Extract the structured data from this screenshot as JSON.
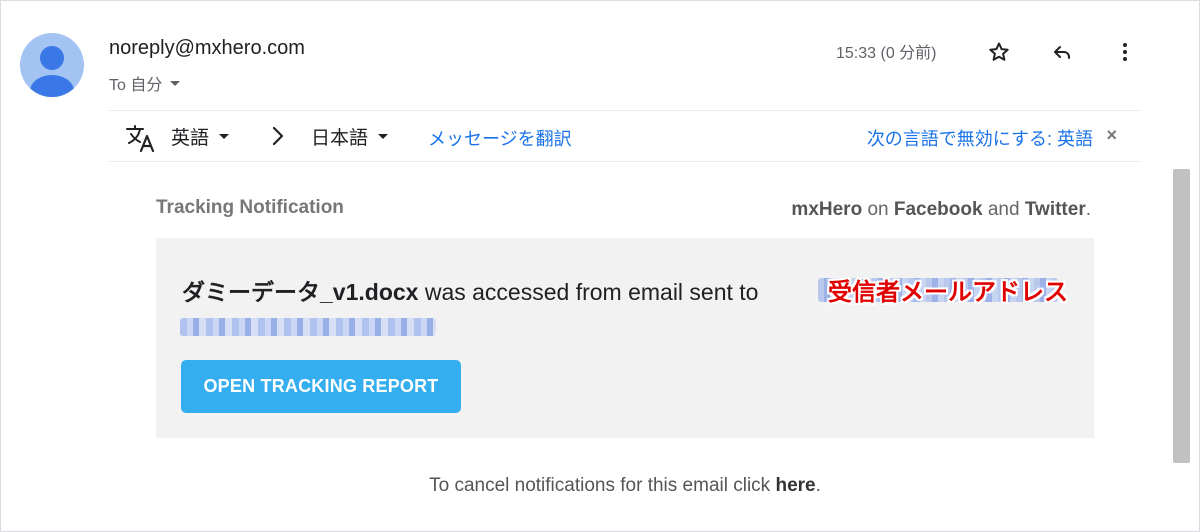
{
  "header": {
    "sender": "noreply@mxhero.com",
    "recipient_label": "To 自分",
    "timestamp": "15:33 (0 分前)",
    "icons": [
      "star-icon",
      "reply-icon",
      "more-vert-icon"
    ]
  },
  "translate_bar": {
    "source_lang": "英語",
    "target_lang": "日本語",
    "translate_link": "メッセージを翻訳",
    "disable_link": "次の言語で無効にする: 英語",
    "close": "×"
  },
  "email_body": {
    "title": "Tracking Notification",
    "social": {
      "brand": "mxHero",
      "on": "on",
      "facebook": "Facebook",
      "and": "and",
      "twitter": "Twitter",
      "period": "."
    },
    "message": {
      "filename": "ダミーデータ_v1.docx",
      "text": "was accessed from email sent to",
      "annotation": "受信者メールアドレス"
    },
    "button_label": "OPEN TRACKING REPORT",
    "cancel": {
      "text": "To cancel notifications for this email click",
      "link": "here",
      "period": "."
    }
  },
  "colors": {
    "accent_blue": "#1a73e8",
    "button_blue": "#35aef0",
    "annotation_red": "#e00000",
    "panel_bg": "#f2f2f2"
  }
}
